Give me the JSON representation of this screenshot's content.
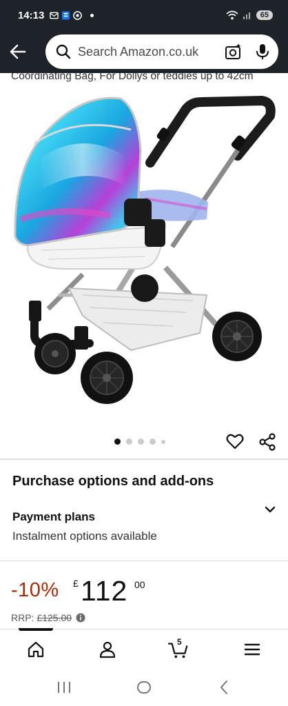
{
  "status_bar": {
    "time": "14:13",
    "battery": "65"
  },
  "header": {
    "search_placeholder": "Search Amazon.co.uk"
  },
  "product": {
    "title_fragment": "Coordinating Bag, For Dollys or teddies up to 42cm",
    "image_count": 5,
    "active_image": 0
  },
  "purchase": {
    "heading": "Purchase options and add-ons",
    "plan_title": "Payment plans",
    "plan_subtitle": "Instalment options available"
  },
  "price": {
    "discount": "-10%",
    "currency": "£",
    "whole": "112",
    "fraction": "00",
    "rrp_label": "RRP:",
    "rrp_value": "£125.00"
  },
  "nav": {
    "cart_count": "5"
  },
  "colors": {
    "header_bg": "#1e2329",
    "discount_red": "#b12704"
  }
}
